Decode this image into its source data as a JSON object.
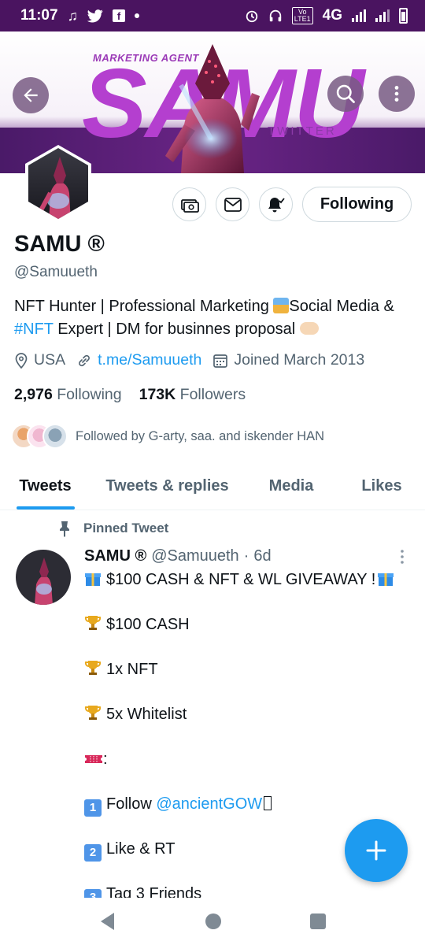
{
  "status_bar": {
    "time": "11:07",
    "network": "4G",
    "volte": "Vo\nLTE1"
  },
  "banner": {
    "subtitle": "MARKETING AGENT",
    "title": "SAMU",
    "tag": "TWITTER",
    "accent_color": "#b43fcf",
    "strip_color": "#4a1a68"
  },
  "header": {
    "back_icon": "arrow-left-icon",
    "search_icon": "search-icon",
    "more_icon": "more-vertical-icon"
  },
  "profile": {
    "name": "SAMU ®",
    "handle": "@Samuueth",
    "bio_part1": "NFT Hunter | Professional Marketing ",
    "bio_part2": "Social Media & ",
    "bio_tag": "#NFT",
    "bio_part3": " Expert | DM for businnes proposal ",
    "location": "USA",
    "link": "t.me/Samuueth",
    "joined": "Joined March 2013",
    "following_count": "2,976",
    "following_label": "Following",
    "followers_count": "173K",
    "followers_label": "Followers",
    "followed_by": "Followed by G-arty, saa. and iskender HAN",
    "follow_button": "Following"
  },
  "actions": {
    "tip_icon": "money-icon",
    "message_icon": "mail-icon",
    "notify_icon": "bell-icon"
  },
  "tabs": [
    {
      "label": "Tweets",
      "active": true
    },
    {
      "label": "Tweets & replies",
      "active": false
    },
    {
      "label": "Media",
      "active": false
    },
    {
      "label": "Likes",
      "active": false
    }
  ],
  "tweet": {
    "pinned_label": "Pinned Tweet",
    "name": "SAMU ®",
    "handle": "@Samuueth",
    "dot": "·",
    "time": "6d",
    "lines": {
      "title": "$100 CASH & NFT & WL GIVEAWAY !",
      "prize1": "$100 CASH",
      "prize2": "1x NFT",
      "prize3": "5x Whitelist",
      "colon": ":",
      "step1_text": "Follow ",
      "step1_mention": "@ancientGOW",
      "step2": "Like & RT",
      "step3": "Tag 3 Friends"
    }
  },
  "fab": {
    "icon": "compose-plus-icon"
  },
  "nav": {
    "back": "nav-back-icon",
    "home": "nav-home-icon",
    "recents": "nav-recents-icon"
  }
}
